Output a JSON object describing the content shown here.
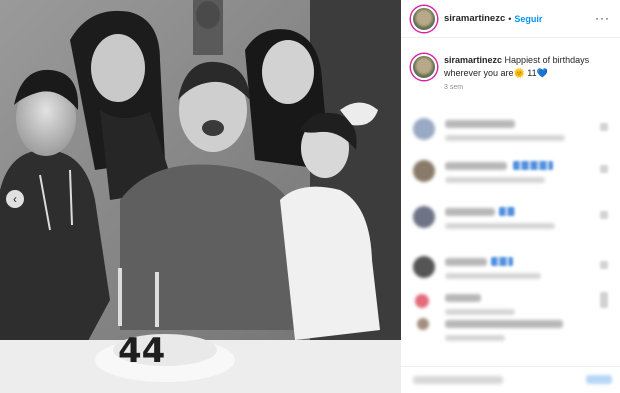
{
  "post": {
    "username": "siramartinezc",
    "separator": "•",
    "follow_label": "Seguir",
    "more_glyph": "···",
    "caption_username": "siramartinezc",
    "caption_text": "Happiest of birthdays wherever you are",
    "caption_sun": "🌞",
    "caption_number": "11",
    "caption_heart": "💙",
    "time_ago": "3 sem"
  },
  "photo": {
    "style": "black-and-white",
    "prev_glyph": "‹"
  },
  "colors": {
    "follow_blue": "#0095f6",
    "story_ring": "#d6249f",
    "heart_blue": "#1877f2"
  }
}
